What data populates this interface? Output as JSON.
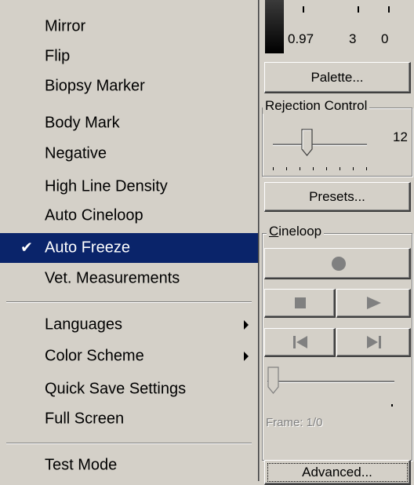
{
  "menu": {
    "items": [
      {
        "label": "Mirror"
      },
      {
        "label": "Flip"
      },
      {
        "label": "Biopsy Marker"
      },
      {
        "label": "Body Mark"
      },
      {
        "label": "Negative"
      },
      {
        "label": "High Line Density"
      },
      {
        "label": "Auto Cineloop"
      },
      {
        "label": "Auto Freeze",
        "checked": true,
        "highlighted": true
      },
      {
        "label": "Vet. Measurements"
      },
      {
        "label": "Languages",
        "submenu": true
      },
      {
        "label": "Color Scheme",
        "submenu": true
      },
      {
        "label": "Quick Save Settings"
      },
      {
        "label": "Full Screen"
      },
      {
        "label": "Test Mode"
      }
    ],
    "check_glyph": "✔",
    "highlight_color": "#0a246a"
  },
  "panel": {
    "readout": {
      "values": [
        "0.97",
        "3",
        "0"
      ]
    },
    "palette_button": "Palette...",
    "rejection": {
      "label_pre": "Re",
      "label_u": "j",
      "label_post": "ection Control",
      "value": "12",
      "slider_fraction": 0.35
    },
    "presets_button": "Presets...",
    "cineloop": {
      "label_u": "C",
      "label_post": "ineloop",
      "record_icon": "record-icon",
      "stop_icon": "stop-icon",
      "play_icon": "play-icon",
      "first_icon": "skip-first-icon",
      "last_icon": "skip-last-icon",
      "frame_text": "Frame: 1/0",
      "frame_slider_fraction": 0.0
    },
    "advanced_button": "Advanced..."
  }
}
